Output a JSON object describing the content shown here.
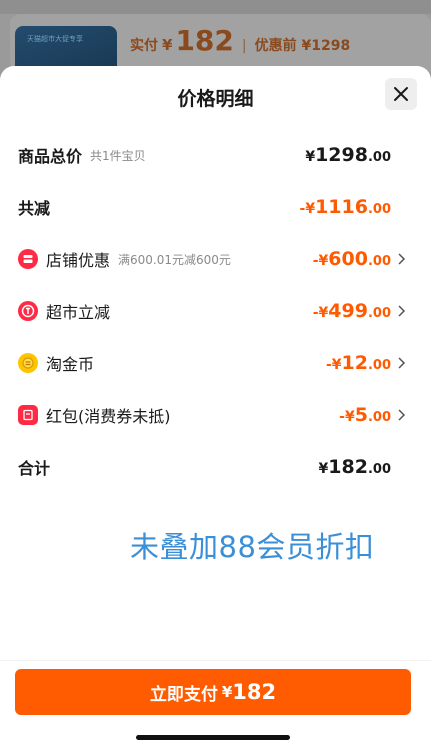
{
  "background": {
    "thumb_caption": "天猫超市大促专享",
    "paid_label": "实付",
    "paid_symbol": "¥",
    "paid_value": "182",
    "separator": "|",
    "before_discount": "优惠前 ¥1298"
  },
  "sheet": {
    "title": "价格明细",
    "close_icon": "close-icon"
  },
  "rows": {
    "goods_total": {
      "label": "商品总价",
      "sub": "共1件宝贝",
      "prefix": "¥",
      "integer": "1298",
      "decimal": ".00"
    },
    "total_reduction": {
      "label": "共减",
      "prefix": "-¥",
      "integer": "1116",
      "decimal": ".00"
    },
    "store_discount": {
      "label": "店铺优惠",
      "sub": "满600.01元减600元",
      "prefix": "-¥",
      "integer": "600",
      "decimal": ".00",
      "icon": "store-coupon-icon"
    },
    "supermarket_reduction": {
      "label": "超市立减",
      "prefix": "-¥",
      "integer": "499",
      "decimal": ".00",
      "icon": "supermarket-icon"
    },
    "taojinbi": {
      "label": "淘金币",
      "prefix": "-¥",
      "integer": "12",
      "decimal": ".00",
      "icon": "gold-coin-icon"
    },
    "red_packet": {
      "label": "红包(消费券未抵)",
      "prefix": "-¥",
      "integer": "5",
      "decimal": ".00",
      "icon": "red-packet-icon"
    },
    "grand_total": {
      "label": "合计",
      "prefix": "¥",
      "integer": "182",
      "decimal": ".00"
    }
  },
  "note": "未叠加88会员折扣",
  "pay_button": {
    "label": "立即支付",
    "symbol": "¥",
    "value": "182"
  },
  "colors": {
    "accent": "#ff5b00",
    "note_blue": "#3b8fd6",
    "text": "#1a1a1a",
    "muted": "#8a8a8a"
  }
}
